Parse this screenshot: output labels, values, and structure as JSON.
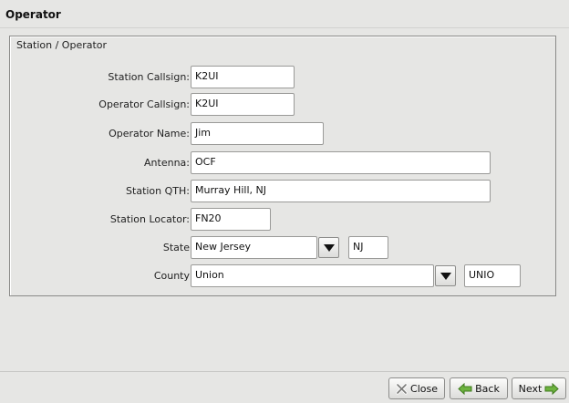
{
  "header": {
    "title": "Operator"
  },
  "group": {
    "title": "Station / Operator"
  },
  "fields": {
    "station_callsign": {
      "label": "Station Callsign:",
      "value": "K2UI"
    },
    "operator_callsign": {
      "label": "Operator Callsign:",
      "value": "K2UI"
    },
    "operator_name": {
      "label": "Operator Name:",
      "value": "Jim"
    },
    "antenna": {
      "label": "Antenna:",
      "value": "OCF"
    },
    "station_qth": {
      "label": "Station QTH:",
      "value": "Murray Hill, NJ"
    },
    "station_locator": {
      "label": "Station Locator:",
      "value": "FN20"
    },
    "state": {
      "label": "State",
      "value": "New Jersey",
      "abbrev": "NJ"
    },
    "county": {
      "label": "County",
      "value": "Union",
      "abbrev": "UNIO"
    }
  },
  "footer": {
    "close_label": "Close",
    "back_label": "Back",
    "next_label": "Next"
  },
  "icons": {
    "close": "close-x-icon",
    "back": "arrow-left-icon",
    "next": "arrow-right-icon",
    "dropdown": "chevron-down-icon"
  },
  "colors": {
    "window_bg": "#e6e6e4",
    "arrow_green": "#5aa02c"
  }
}
